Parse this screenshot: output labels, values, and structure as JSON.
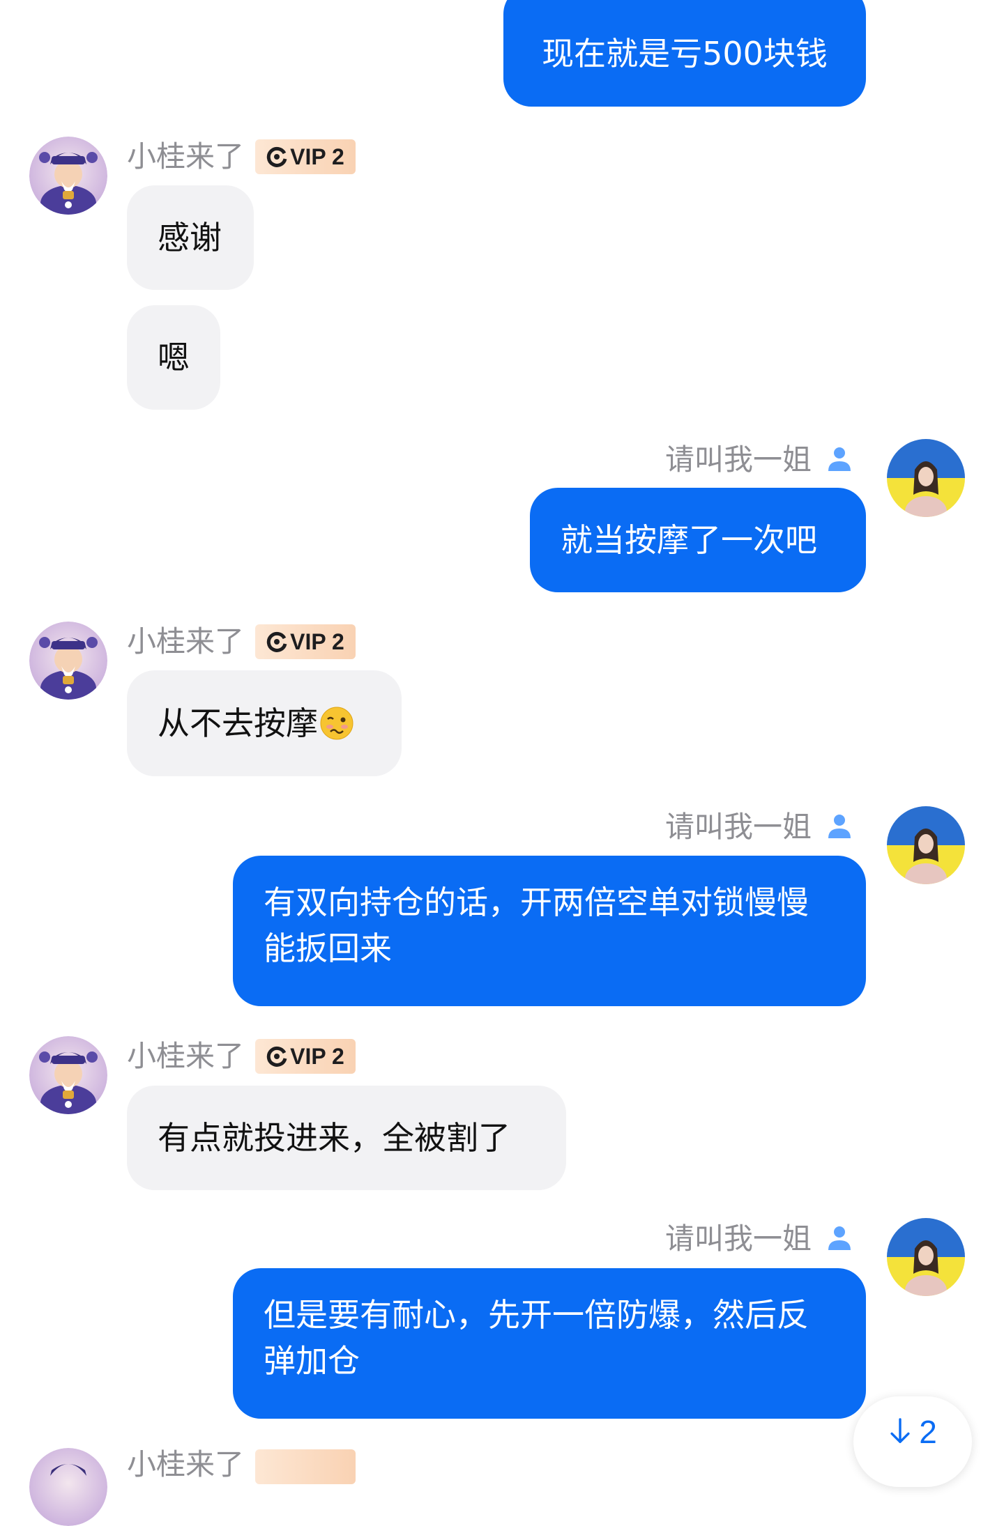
{
  "colors": {
    "outgoing_bubble": "#0a6cf4",
    "incoming_bubble": "#f2f2f4",
    "name_text": "#8e8e93",
    "vip_badge": "#f9d2b3"
  },
  "users": {
    "other": {
      "name": "小桂来了",
      "badge": "VIP 2",
      "avatar": "god-of-wealth-avatar"
    },
    "me": {
      "name": "请叫我一姐",
      "avatar": "woman-photo-avatar",
      "icon": "person-icon"
    }
  },
  "messages": [
    {
      "from": "me",
      "text": "现在就是亏500块钱"
    },
    {
      "from": "other",
      "text": "感谢"
    },
    {
      "from": "other",
      "text": "嗯"
    },
    {
      "from": "me",
      "text": "就当按摩了一次吧"
    },
    {
      "from": "other",
      "text": "从不去按摩",
      "emoji": "woozy-face"
    },
    {
      "from": "me",
      "text": "有双向持仓的话，开两倍空单对锁慢慢能扳回来"
    },
    {
      "from": "other",
      "text": "有点就投进来，全被割了"
    },
    {
      "from": "me",
      "text": "但是要有耐心，先开一倍防爆，然后反弹加仓"
    }
  ],
  "scroll_button": {
    "icon": "arrow-down-icon",
    "count": "2"
  }
}
